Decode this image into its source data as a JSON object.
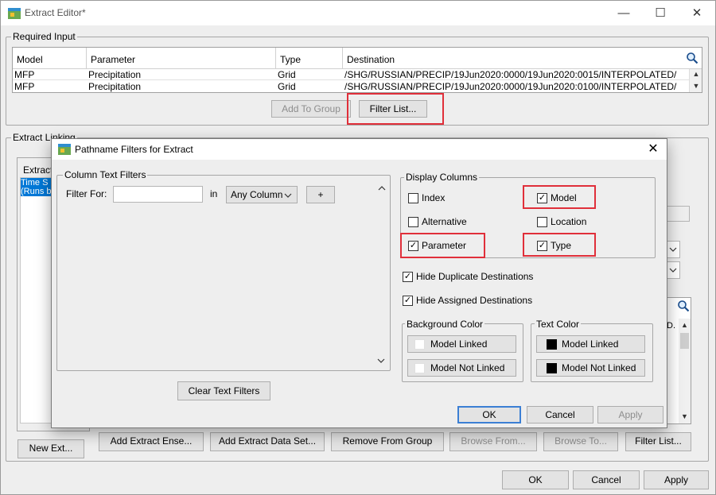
{
  "window": {
    "title": "Extract Editor*",
    "controls": [
      "—",
      "☐",
      "✕"
    ]
  },
  "required_input": {
    "legend": "Required Input",
    "columns": [
      "Model",
      "Parameter",
      "Type",
      "Destination"
    ],
    "rows": [
      {
        "model": "MFP",
        "parameter": "Precipitation",
        "type": "Grid",
        "destination": "/SHG/RUSSIAN/PRECIP/19Jun2020:0000/19Jun2020:0015/INTERPOLATED/"
      },
      {
        "model": "MFP",
        "parameter": "Precipitation",
        "type": "Grid",
        "destination": "/SHG/RUSSIAN/PRECIP/19Jun2020:0000/19Jun2020:0100/INTERPOLATED/"
      }
    ],
    "add_to_group": "Add To Group",
    "filter_list": "Filter List..."
  },
  "extract_linking": {
    "legend": "Extract Linking",
    "list_header": "Extract",
    "list_items": [
      "Time S",
      "(Runs b"
    ],
    "new_extract": "New Ext...",
    "buttons": {
      "add_extract_ensemble": "Add Extract Ense...",
      "add_extract_data_set": "Add Extract Data Set...",
      "remove_from_group": "Remove From Group",
      "browse_from": "Browse From...",
      "browse_to": "Browse To...",
      "filter_list": "Filter List..."
    },
    "partial_header": "D."
  },
  "footer": {
    "ok": "OK",
    "cancel": "Cancel",
    "apply": "Apply"
  },
  "dialog": {
    "title": "Pathname Filters for Extract",
    "column_text_filters": {
      "legend": "Column Text Filters",
      "filter_for_label": "Filter For:",
      "filter_for_value": "",
      "in_label": "in",
      "column_select": "Any Column",
      "add_label": "+"
    },
    "clear_text_filters": "Clear Text Filters",
    "display_columns": {
      "legend": "Display Columns",
      "index": {
        "label": "Index",
        "checked": false
      },
      "model": {
        "label": "Model",
        "checked": true
      },
      "alternative": {
        "label": "Alternative",
        "checked": false
      },
      "location": {
        "label": "Location",
        "checked": false
      },
      "parameter": {
        "label": "Parameter",
        "checked": true
      },
      "type": {
        "label": "Type",
        "checked": true
      }
    },
    "hide_duplicate": {
      "label": "Hide Duplicate Destinations",
      "checked": true
    },
    "hide_assigned": {
      "label": "Hide Assigned Destinations",
      "checked": true
    },
    "background_color": {
      "legend": "Background Color",
      "linked": "Model Linked",
      "not_linked": "Model Not Linked",
      "linked_color": "#ffffff",
      "not_linked_color": "#ffffff"
    },
    "text_color": {
      "legend": "Text Color",
      "linked": "Model Linked",
      "not_linked": "Model Not Linked",
      "linked_color": "#000000",
      "not_linked_color": "#000000"
    },
    "ok": "OK",
    "cancel": "Cancel",
    "apply": "Apply"
  },
  "colors": {
    "highlight": "#e02f3a",
    "selection": "#0078d7",
    "default_button": "#3b7fd4"
  }
}
